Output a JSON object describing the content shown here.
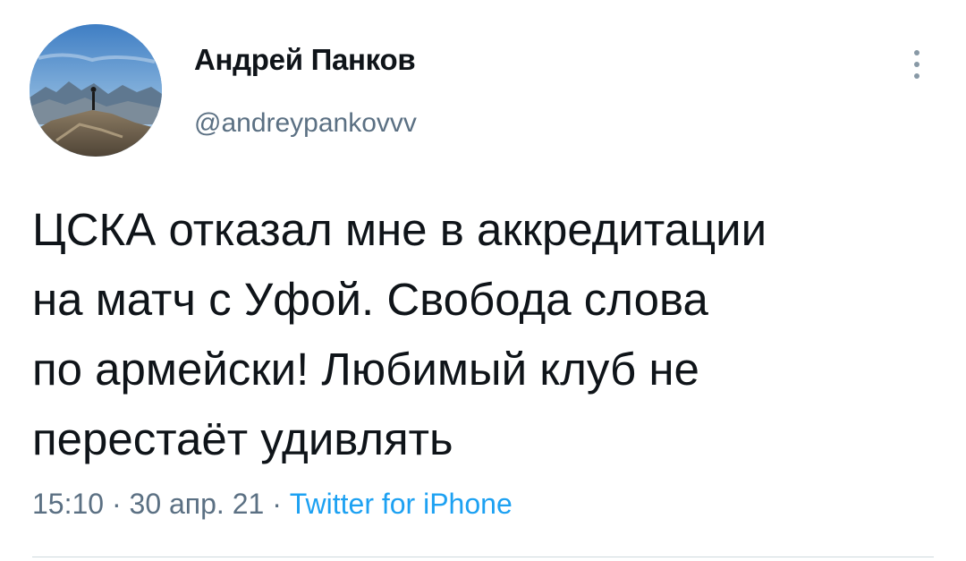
{
  "tweet": {
    "display_name": "Андрей Панков",
    "handle": "@andreypankovvv",
    "text": "ЦСКА отказал мне в аккредитации\nна матч с Уфой. Свобода слова\nпо армейски! Любимый клуб не\nперестаёт удивлять",
    "time": "15:10",
    "separator": "·",
    "date": "30 апр. 21",
    "source": "Twitter for iPhone"
  },
  "icons": {
    "avatar": "mountain-photo-avatar",
    "more": "vertical-ellipsis-icon"
  },
  "colors": {
    "text": "#0f1419",
    "secondary": "#5b7083",
    "link": "#1da1f2"
  }
}
